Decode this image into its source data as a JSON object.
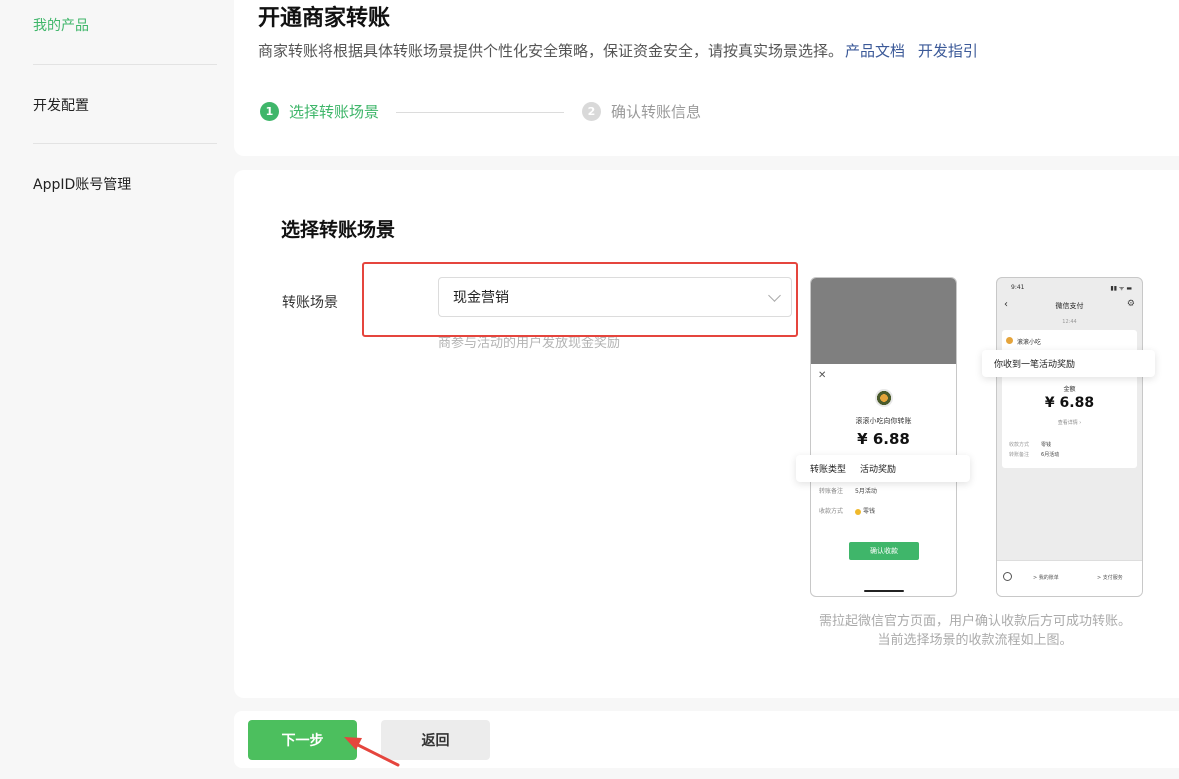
{
  "sidebar": {
    "items": [
      {
        "label": "我的产品"
      },
      {
        "label": "开发配置"
      },
      {
        "label": "AppID账号管理"
      }
    ]
  },
  "header": {
    "title": "开通商家转账",
    "description": "商家转账将根据具体转账场景提供个性化安全策略，保证资金安全，请按真实场景选择。",
    "link_docs": "产品文档",
    "link_guide": "开发指引"
  },
  "steps": [
    {
      "num": "1",
      "label": "选择转账场景"
    },
    {
      "num": "2",
      "label": "确认转账信息"
    }
  ],
  "main": {
    "section_title": "选择转账场景",
    "field_label": "转账场景",
    "select_value": "现金营销",
    "hint": "商参与活动的用户发放现金奖励"
  },
  "preview": {
    "phone1": {
      "close": "✕",
      "merchant": "滚滚小吃向你转账",
      "amount": "¥ 6.88",
      "callout_key": "转账类型",
      "callout_val": "活动奖励",
      "row1_key": "转账备注",
      "row1_val": "5月活动",
      "row2_key": "收款方式",
      "row2_val": "零钱",
      "button": "确认收款"
    },
    "phone2": {
      "status_time": "9:41",
      "status_icons": "▮▮ ᯤ ▬",
      "back": "‹",
      "title": "微信支付",
      "gear": "⚙",
      "time": "12:44",
      "merchant": "滚滚小吃",
      "callout": "你收到一笔活动奖励",
      "label": "金额",
      "amount": "¥ 6.88",
      "detail": "查看详情 ›",
      "row1_key": "收款方式",
      "row1_val": "零钱",
      "row2_key": "转账备注",
      "row2_val": "6月活动",
      "bottom_left": "> 我的账单",
      "bottom_right": "> 支付服务"
    },
    "caption_line1": "需拉起微信官方页面，用户确认收款后方可成功转账。",
    "caption_line2": "当前选择场景的收款流程如上图。"
  },
  "footer": {
    "next_label": "下一步",
    "back_label": "返回"
  },
  "colors": {
    "accent": "#3fb66a",
    "button_green": "#4cbf5e",
    "link": "#3b5998",
    "highlight_red": "#e5453d"
  },
  "icons": [
    "chevron-down-icon",
    "close-icon",
    "back-icon",
    "gear-icon",
    "coin-icon",
    "arrow-annotation-icon"
  ]
}
